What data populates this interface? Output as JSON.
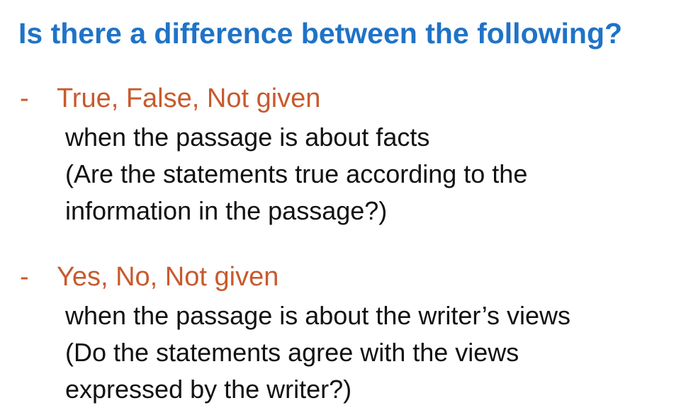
{
  "title": "Is there a difference between the following?",
  "bullet_marker": "-",
  "items": [
    {
      "heading": "True, False, Not given",
      "lines": [
        "when the passage is about facts",
        "(Are the statements true according to the",
        "information in the passage?)"
      ]
    },
    {
      "heading": "Yes, No, Not given",
      "lines": [
        "when the passage is about the writer’s views",
        "(Do the statements agree with the views",
        "expressed by the writer?)"
      ]
    }
  ],
  "colors": {
    "title": "#1f73c7",
    "heading": "#c85a2d",
    "body": "#111111",
    "background": "#ffffff"
  }
}
